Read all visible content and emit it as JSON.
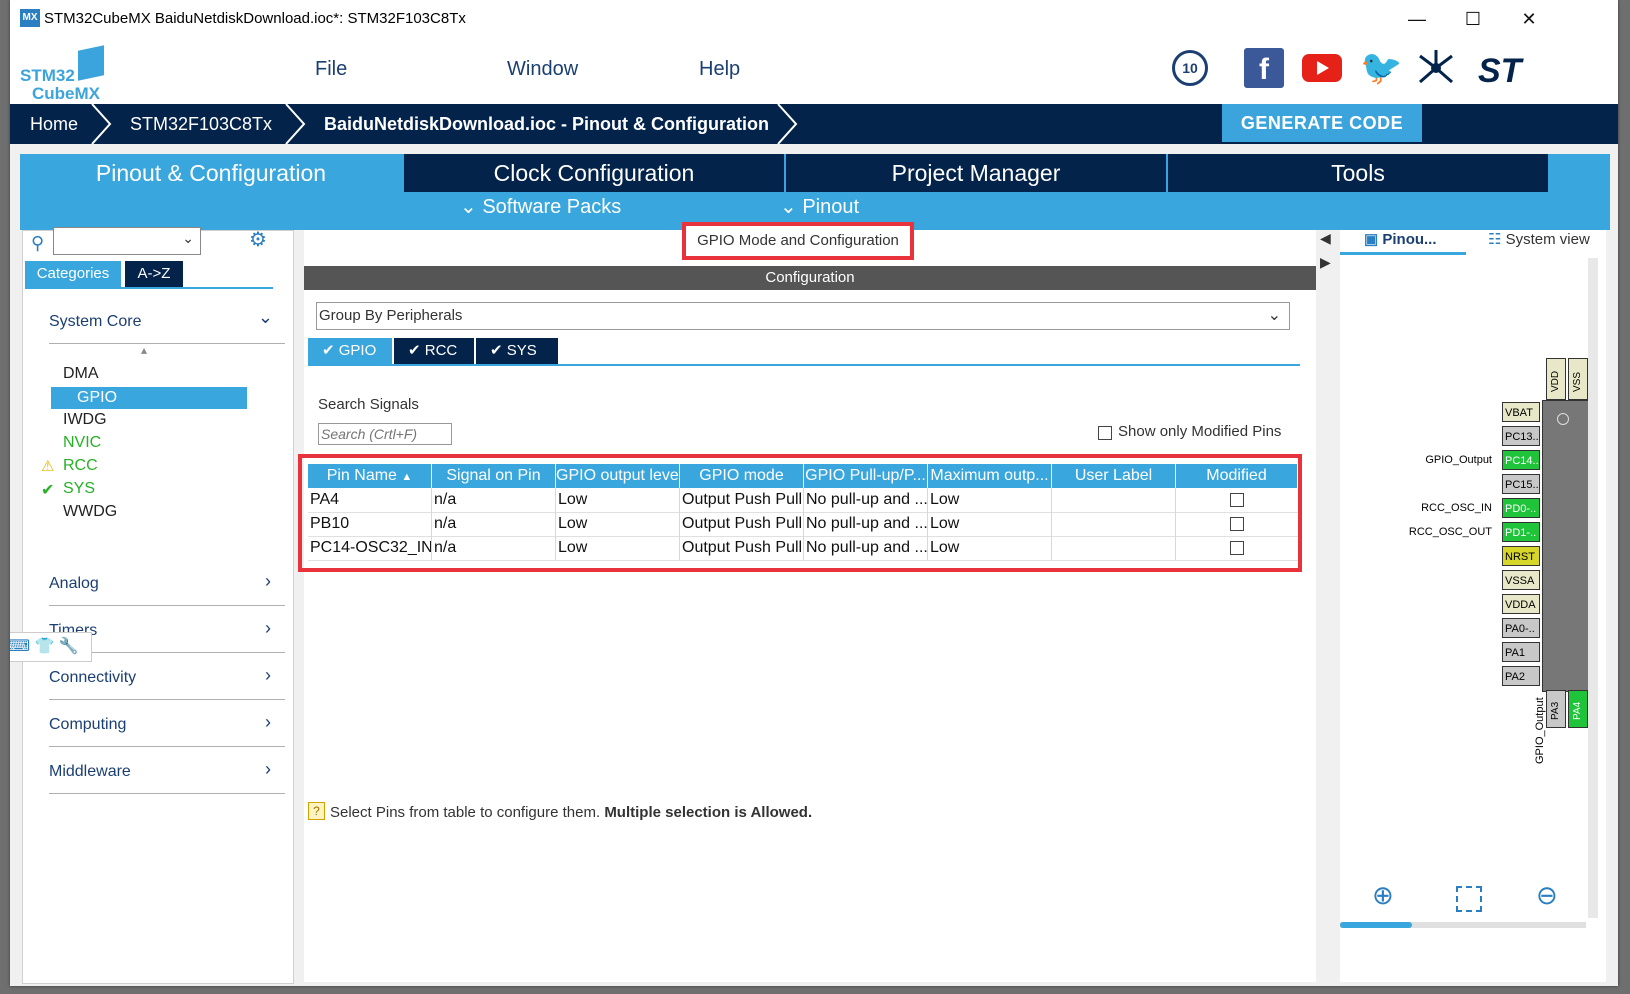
{
  "window": {
    "title": "STM32CubeMX BaiduNetdiskDownload.ioc*: STM32F103C8Tx",
    "app_icon": "MX",
    "controls": {
      "minimize": "—",
      "maximize": "☐",
      "close": "✕"
    }
  },
  "logo": {
    "line1": "STM32",
    "line2": "CubeMX"
  },
  "menu": {
    "file": "File",
    "window": "Window",
    "help": "Help"
  },
  "social": {
    "badge": "10"
  },
  "breadcrumb": {
    "home": "Home",
    "device": "STM32F103C8Tx",
    "project": "BaiduNetdiskDownload.ioc - Pinout & Configuration"
  },
  "generate_button": "GENERATE CODE",
  "tabs": {
    "pinout": "Pinout & Configuration",
    "clock": "Clock Configuration",
    "project": "Project Manager",
    "tools": "Tools"
  },
  "subtabs": {
    "software_packs": "Software Packs",
    "pinout": "Pinout"
  },
  "left": {
    "cat_tab": "Categories",
    "az_tab": "A->Z",
    "groups": {
      "system_core": "System Core",
      "analog": "Analog",
      "timers": "Timers",
      "connectivity": "Connectivity",
      "computing": "Computing",
      "middleware": "Middleware"
    },
    "items": {
      "dma": "DMA",
      "gpio": "GPIO",
      "iwdg": "IWDG",
      "nvic": "NVIC",
      "rcc": "RCC",
      "sys": "SYS",
      "wwdg": "WWDG"
    }
  },
  "mid": {
    "mode_title": "GPIO Mode and Configuration",
    "config_header": "Configuration",
    "group_by": "Group By Peripherals",
    "ptabs": {
      "gpio": "GPIO",
      "rcc": "RCC",
      "sys": "SYS"
    },
    "search_label": "Search Signals",
    "search_placeholder": "Search (Crtl+F)",
    "show_modified": "Show only Modified Pins",
    "table": {
      "headers": {
        "pin": "Pin Name",
        "signal": "Signal on Pin",
        "level": "GPIO output level",
        "mode": "GPIO mode",
        "pull": "GPIO Pull-up/P...",
        "speed": "Maximum outp...",
        "label": "User Label",
        "modified": "Modified"
      },
      "rows": [
        {
          "pin": "PA4",
          "signal": "n/a",
          "level": "Low",
          "mode": "Output Push Pull",
          "pull": "No pull-up and ...",
          "speed": "Low",
          "label": ""
        },
        {
          "pin": "PB10",
          "signal": "n/a",
          "level": "Low",
          "mode": "Output Push Pull",
          "pull": "No pull-up and ...",
          "speed": "Low",
          "label": ""
        },
        {
          "pin": "PC14-OSC32_IN",
          "signal": "n/a",
          "level": "Low",
          "mode": "Output Push Pull",
          "pull": "No pull-up and ...",
          "speed": "Low",
          "label": ""
        }
      ]
    },
    "hint_normal": "Select Pins from table to configure them.",
    "hint_bold": "Multiple selection is Allowed."
  },
  "right": {
    "pinout_tab": "Pinou...",
    "system_tab": "System view",
    "left_pins": [
      "VBAT",
      "PC13..",
      "PC14..",
      "PC15..",
      "PD0-..",
      "PD1-..",
      "NRST",
      "VSSA",
      "VDDA",
      "PA0-..",
      "PA1",
      "PA2"
    ],
    "top_pins": [
      "VDD",
      "VSS"
    ],
    "bottom_pins": [
      "PA3",
      "PA4"
    ],
    "labels": {
      "gpio_output": "GPIO_Output",
      "rcc_osc_in": "RCC_OSC_IN",
      "rcc_osc_out": "RCC_OSC_OUT",
      "gpio_output_v": "GPIO_Output"
    }
  },
  "colors": {
    "accent": "#39a6dd",
    "dark": "#03234b",
    "highlight_box": "#e8323c",
    "pin_green": "#1fc43a"
  }
}
